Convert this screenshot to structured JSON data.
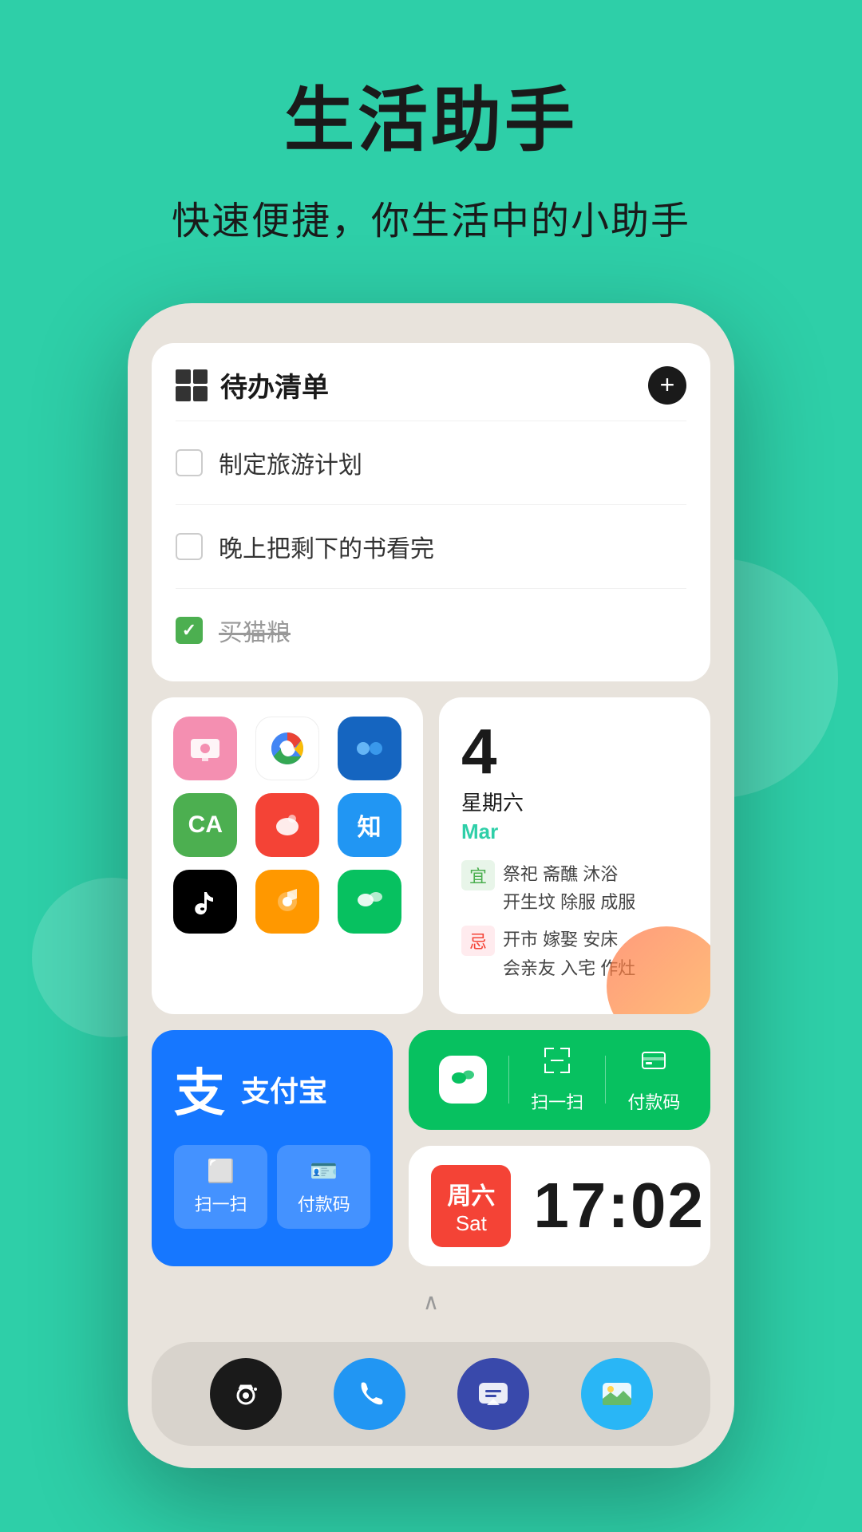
{
  "header": {
    "main_title": "生活助手",
    "subtitle": "快速便捷，你生活中的小助手"
  },
  "todo_widget": {
    "title": "待办清单",
    "add_btn": "+",
    "items": [
      {
        "id": 1,
        "text": "制定旅游计划",
        "checked": false
      },
      {
        "id": 2,
        "text": "晚上把剩下的书看完",
        "checked": false
      },
      {
        "id": 3,
        "text": "买猫粮",
        "checked": true
      }
    ]
  },
  "calendar_widget": {
    "date": "4",
    "weekday": "星期六",
    "month": "Mar",
    "good_label": "宜",
    "good_items": "祭祀 斋醮 沐浴\n开生坟 除服 成服",
    "bad_label": "忌",
    "bad_items": "开市 嫁娶 安床\n会亲友 入宅 作灶"
  },
  "alipay_widget": {
    "logo": "支",
    "name": "支付宝",
    "scan_label": "扫一扫",
    "pay_label": "付款码"
  },
  "wechat_widget": {
    "scan_label": "扫一扫",
    "pay_label": "付款码"
  },
  "clock_widget": {
    "day_zh": "周六",
    "day_en": "Sat",
    "time": "17:02"
  },
  "apps": [
    {
      "color": "app-pink",
      "icon": "📺"
    },
    {
      "color": "app-chrome",
      "icon": "🌐"
    },
    {
      "color": "app-blue-dark",
      "icon": "⚡"
    },
    {
      "color": "app-green",
      "icon": "🅰"
    },
    {
      "color": "app-red",
      "icon": "🔴"
    },
    {
      "color": "app-blue",
      "icon": "📘"
    },
    {
      "color": "app-black",
      "icon": "🎵"
    },
    {
      "color": "app-yellow",
      "icon": "🎵"
    },
    {
      "color": "app-wechat",
      "icon": "💬"
    }
  ],
  "dock": {
    "camera_icon": "📷",
    "phone_icon": "📞",
    "message_icon": "💬",
    "gallery_icon": "🏞"
  }
}
